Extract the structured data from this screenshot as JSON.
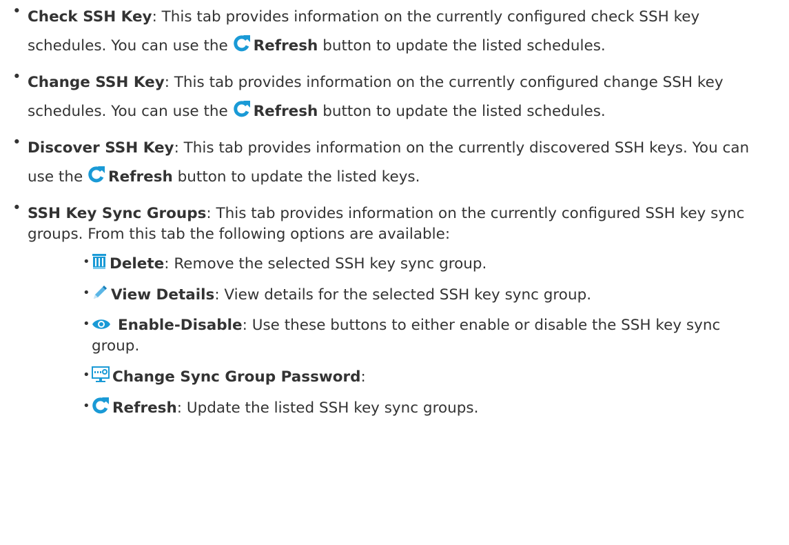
{
  "items": [
    {
      "title": "Check SSH Key",
      "text_before": ": This tab provides information on the currently configured check SSH key schedules. You can use the ",
      "button": "Refresh",
      "text_after": " button to update the listed schedules."
    },
    {
      "title": "Change SSH Key",
      "text_before": ": This tab provides information on the currently configured change SSH key schedules. You can use the ",
      "button": "Refresh",
      "text_after": " button to update the listed schedules."
    },
    {
      "title": "Discover SSH Key",
      "text_before": ": This tab provides information on the currently discovered SSH keys. You can use the ",
      "button": "Refresh",
      "text_after": " button to update the listed keys."
    },
    {
      "title": "SSH Key Sync Groups",
      "text": ": This tab provides information on the currently configured SSH key sync groups. From this tab the following options are available:"
    }
  ],
  "options": [
    {
      "icon": "trash-icon",
      "label": "Delete",
      "text": ": Remove the selected SSH key sync group."
    },
    {
      "icon": "pencil-icon",
      "label": "View Details",
      "text": ": View details for the selected SSH key sync group."
    },
    {
      "icon": "eye-icon",
      "label": "Enable-Disable",
      "text": ": Use these buttons to either enable or disable the SSH key sync group."
    },
    {
      "icon": "monitor-password-icon",
      "label": "Change Sync Group Password",
      "text": ":"
    },
    {
      "icon": "refresh-icon",
      "label": "Refresh",
      "text": ": Update the listed SSH key sync groups."
    }
  ],
  "bullet": "•",
  "colors": {
    "icon_blue": "#1a9ad6",
    "text": "#333333"
  }
}
